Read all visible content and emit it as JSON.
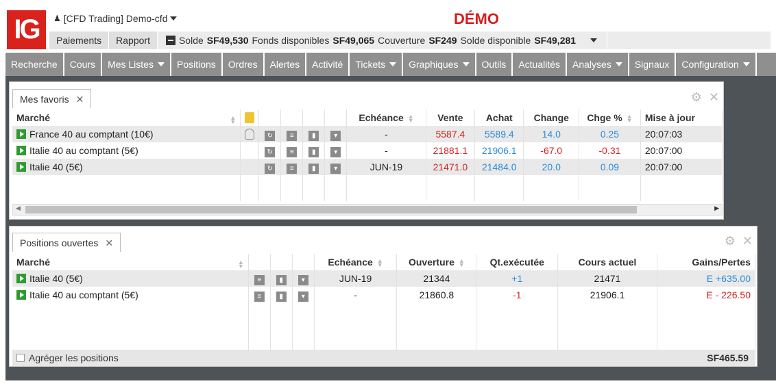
{
  "header": {
    "logo": "IG",
    "account": "[CFD Trading] Demo-cfd",
    "mode": "DÉMO",
    "tabs": [
      "Paiements",
      "Rapport"
    ],
    "solde_label": "Solde",
    "solde": "SF49,530",
    "fonds_label": "Fonds disponibles",
    "fonds": "SF49,065",
    "couverture_label": "Couverture",
    "couverture": "SF249",
    "dispo_label": "Solde disponible",
    "dispo": "SF49,281"
  },
  "nav": [
    {
      "label": "Recherche",
      "dd": false
    },
    {
      "label": "Cours",
      "dd": false
    },
    {
      "label": "Mes Listes",
      "dd": true
    },
    {
      "label": "Positions",
      "dd": false
    },
    {
      "label": "Ordres",
      "dd": false
    },
    {
      "label": "Alertes",
      "dd": false
    },
    {
      "label": "Activité",
      "dd": false
    },
    {
      "label": "Tickets",
      "dd": true
    },
    {
      "label": "Graphiques",
      "dd": true
    },
    {
      "label": "Outils",
      "dd": false
    },
    {
      "label": "Actualités",
      "dd": false
    },
    {
      "label": "Analyses",
      "dd": true
    },
    {
      "label": "Signaux",
      "dd": false
    },
    {
      "label": "Configuration",
      "dd": true
    }
  ],
  "favoris": {
    "tab": "Mes favoris",
    "headers": {
      "marche": "Marché",
      "echeance": "Echéance",
      "vente": "Vente",
      "achat": "Achat",
      "change": "Change",
      "chge": "Chge %",
      "maj": "Mise à jour"
    },
    "rows": [
      {
        "marche": "France 40 au comptant (10€)",
        "echeance": "-",
        "vente": "5587.4",
        "achat": "5589.4",
        "change": "14.0",
        "chge": "0.25",
        "maj": "20:07:03"
      },
      {
        "marche": "Italie 40 au comptant (5€)",
        "echeance": "-",
        "vente": "21881.1",
        "achat": "21906.1",
        "change": "-67.0",
        "chge": "-0.31",
        "maj": "20:07:00"
      },
      {
        "marche": "Italie 40 (5€)",
        "echeance": "JUN-19",
        "vente": "21471.0",
        "achat": "21484.0",
        "change": "20.0",
        "chge": "0.09",
        "maj": "20:07:00"
      }
    ]
  },
  "positions": {
    "tab": "Positions ouvertes",
    "headers": {
      "marche": "Marché",
      "echeance": "Echéance",
      "ouverture": "Ouverture",
      "qt": "Qt.exécutée",
      "cours": "Cours actuel",
      "gains": "Gains/Pertes"
    },
    "rows": [
      {
        "marche": "Italie 40 (5€)",
        "echeance": "JUN-19",
        "ouverture": "21344",
        "qt": "+1",
        "cours": "21471",
        "gains": "E +635.00"
      },
      {
        "marche": "Italie 40 au comptant (5€)",
        "echeance": "-",
        "ouverture": "21860.8",
        "qt": "-1",
        "cours": "21906.1",
        "gains": "E - 226.50"
      }
    ],
    "aggregate_label": "Agréger les positions",
    "total": "SF465.59"
  }
}
